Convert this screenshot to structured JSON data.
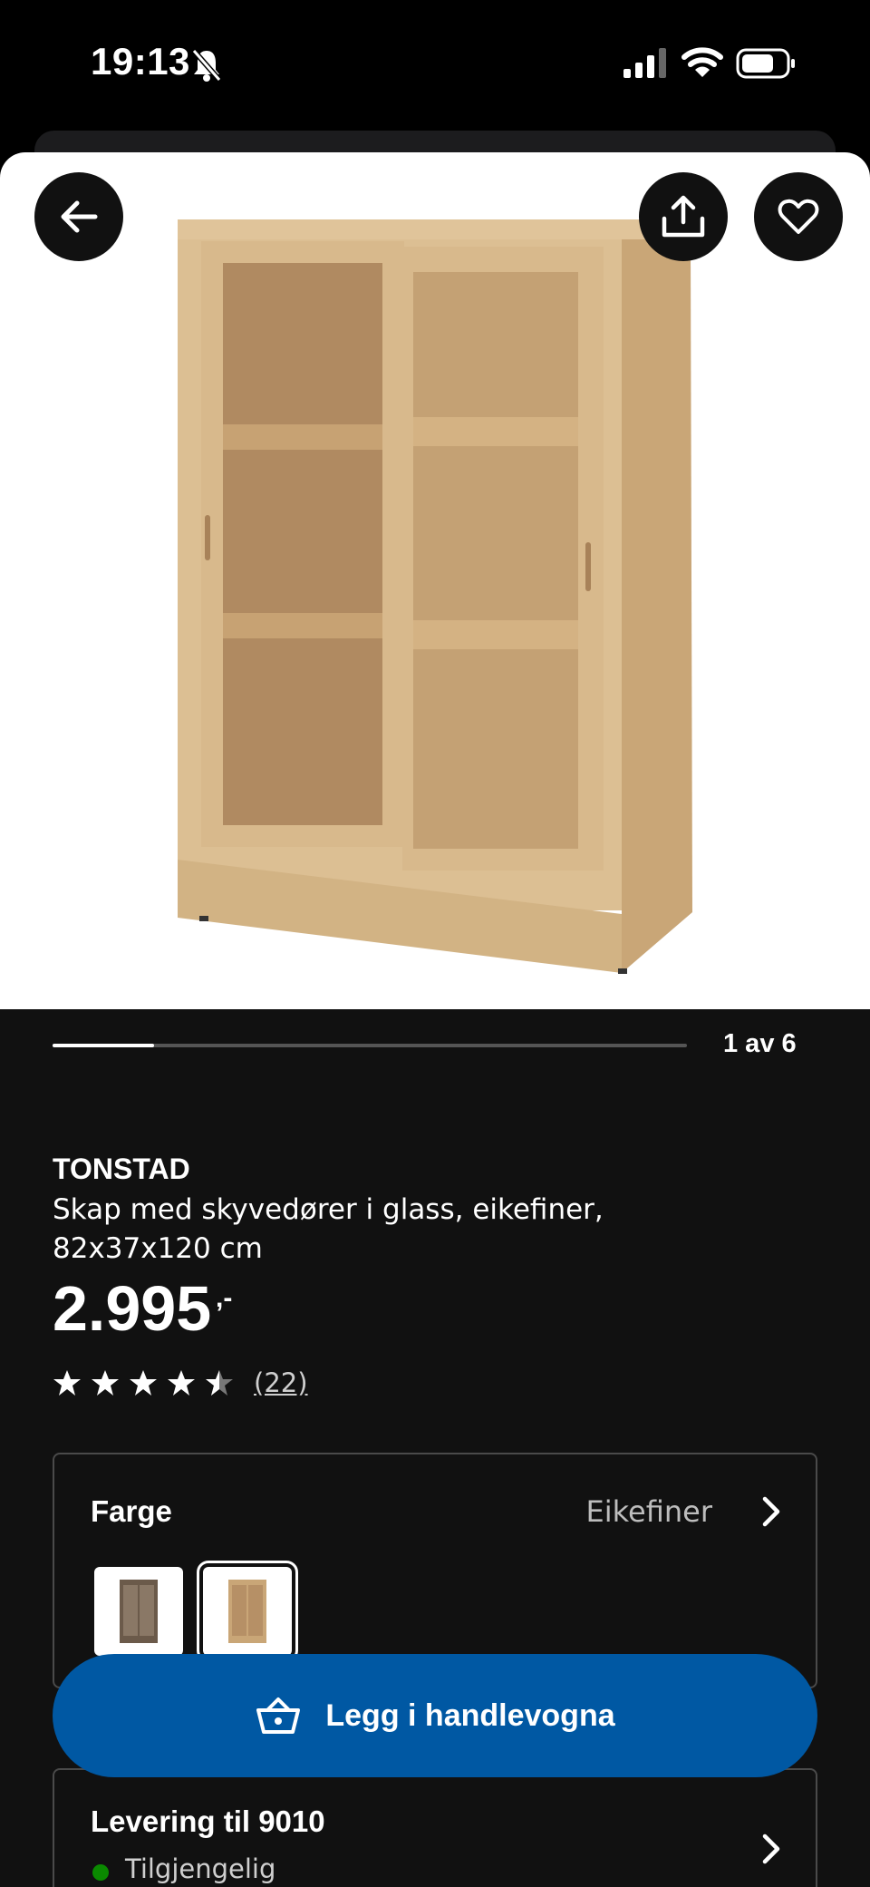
{
  "status_bar": {
    "time": "19:13"
  },
  "image_carousel": {
    "current_index": 1,
    "total": 6,
    "indicator": "1 av 6",
    "progress_fraction": 0.16
  },
  "product": {
    "brand": "TONSTAD",
    "description": "Skap med skyvedører i glass, eikefiner, 82x37x120 cm",
    "price": "2.995",
    "price_suffix": ",-",
    "rating_stars": 4.5,
    "review_count": "(22)"
  },
  "color_selector": {
    "label": "Farge",
    "value": "Eikefiner",
    "selected_index": 1
  },
  "add_to_cart": {
    "label": "Legg i handlevogna"
  },
  "delivery": {
    "title": "Levering til 9010",
    "status": "Tilgjengelig",
    "status_color": "#0a8a00"
  },
  "colors": {
    "accent": "#0058a3",
    "background": "#111111"
  }
}
